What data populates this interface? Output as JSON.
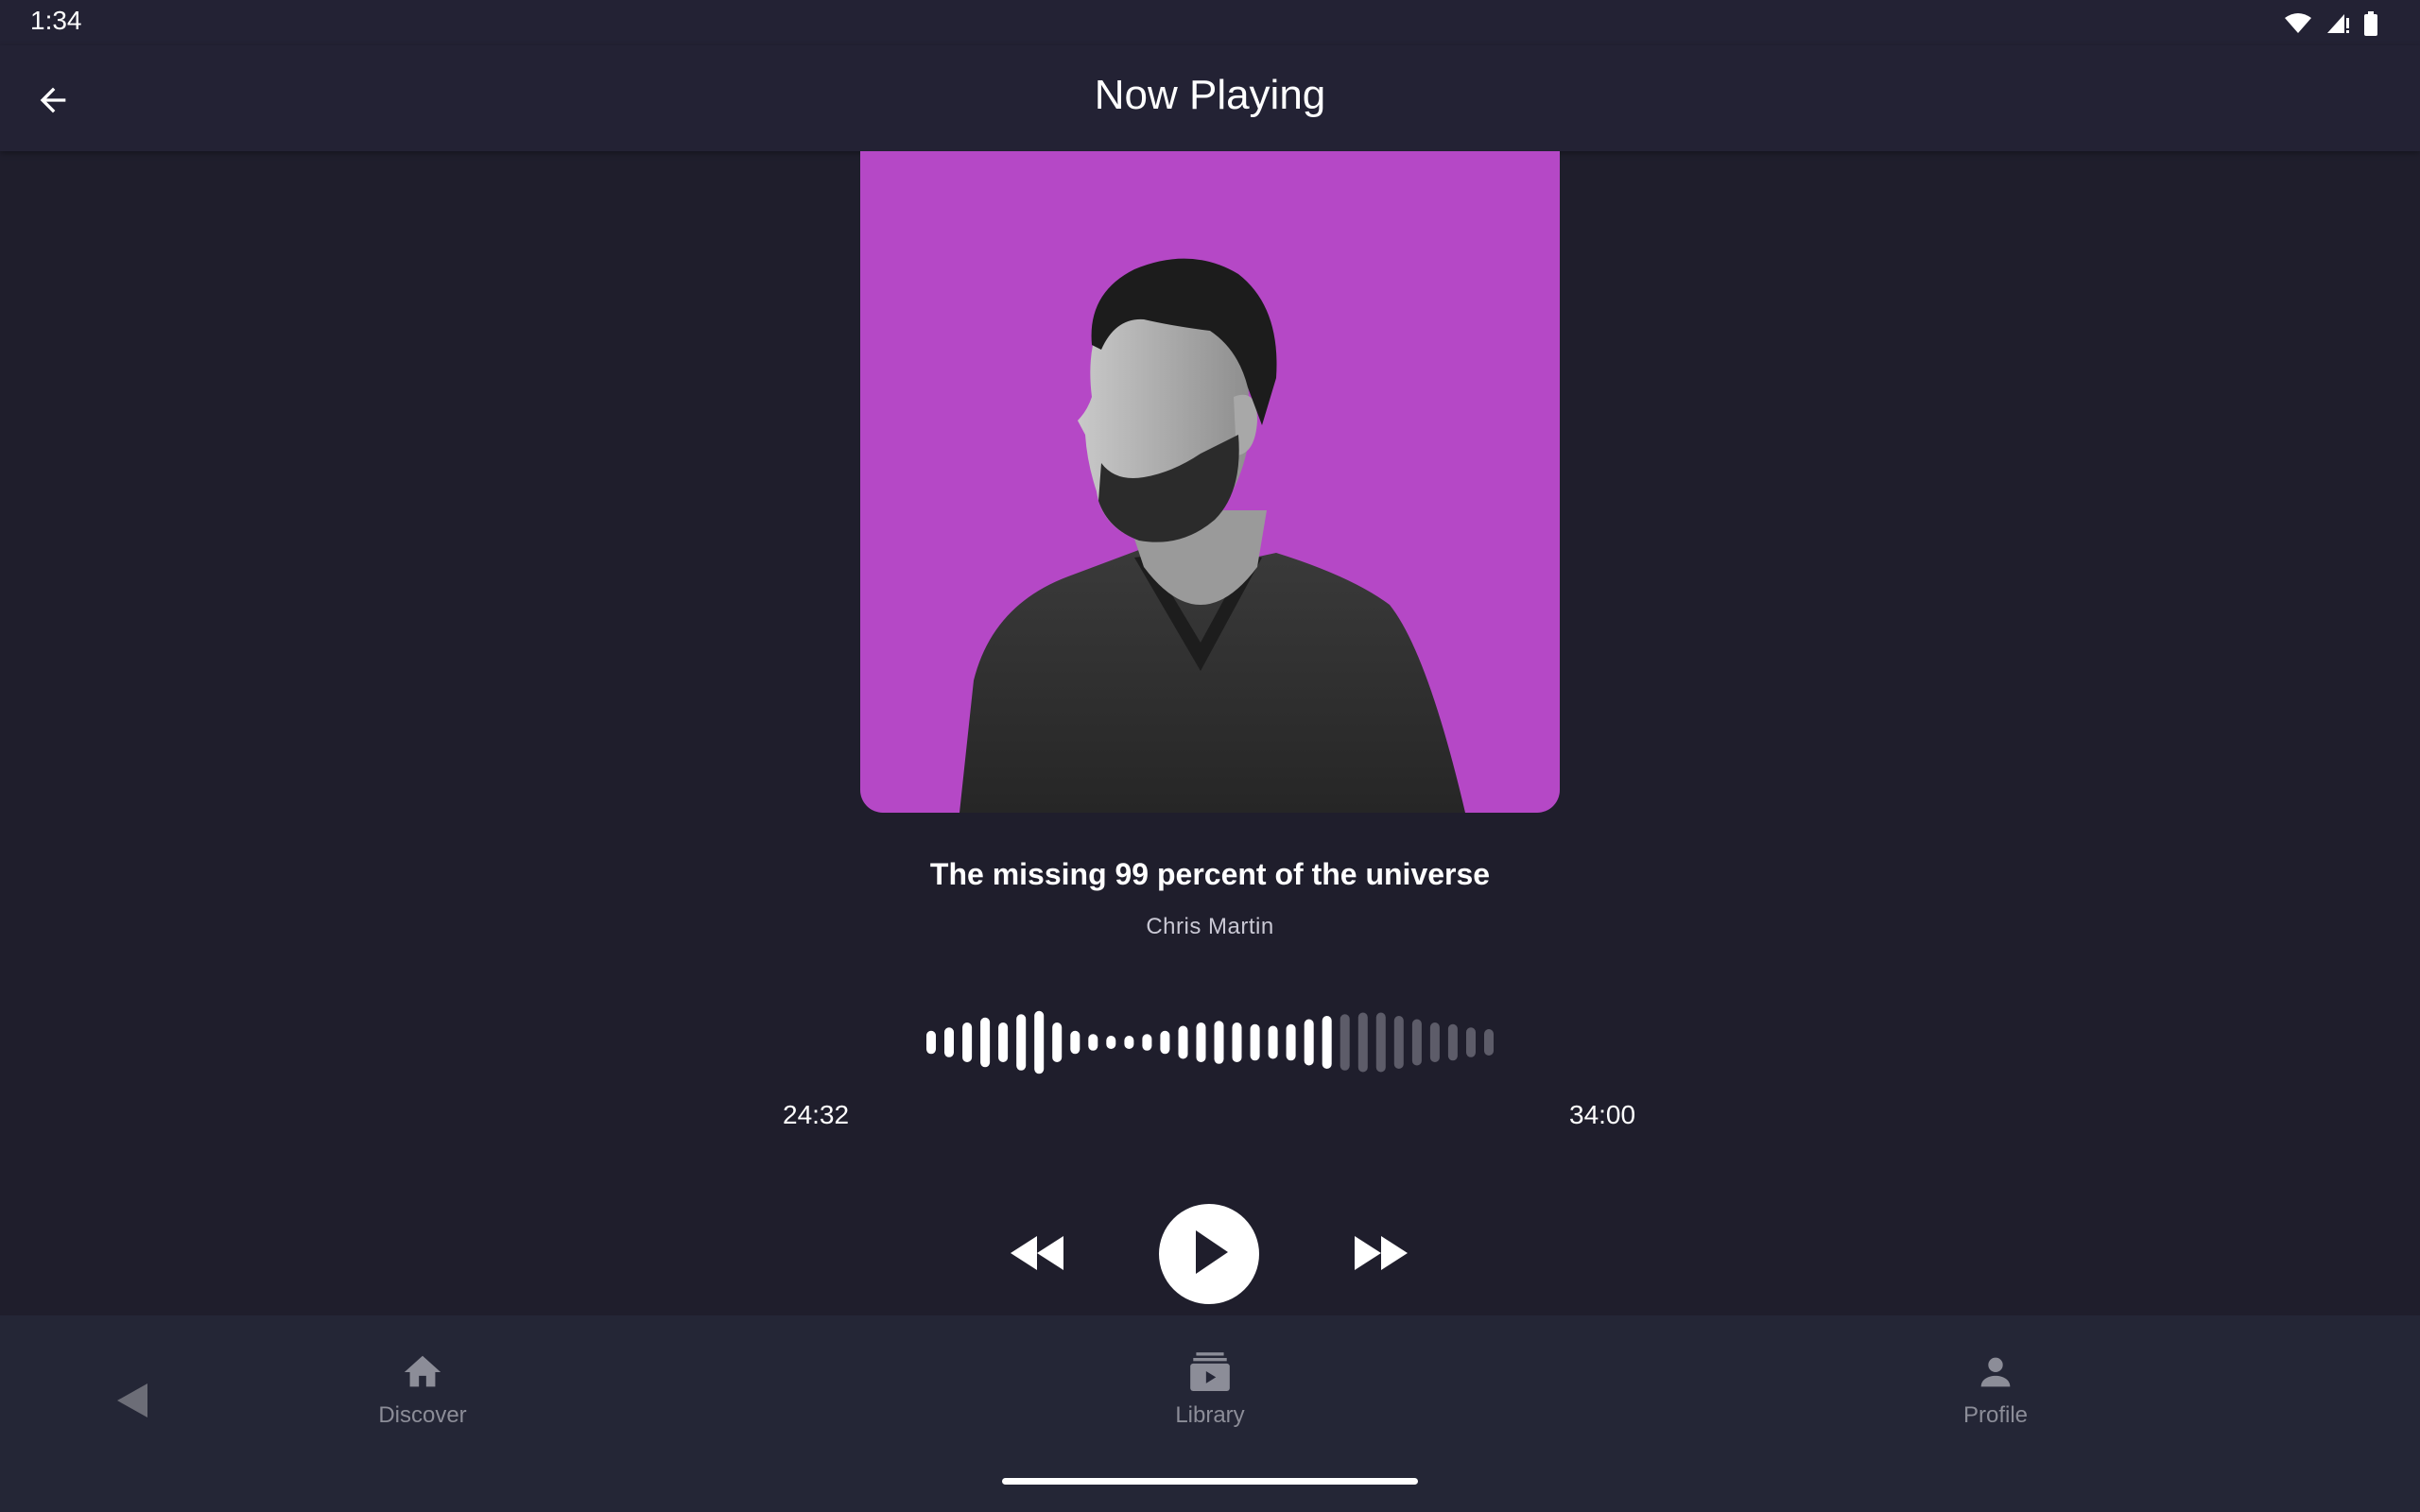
{
  "status_bar": {
    "time": "1:34",
    "icons": [
      "wifi-icon",
      "signal-icon",
      "battery-icon"
    ]
  },
  "app_bar": {
    "title": "Now Playing",
    "back_icon": "arrow-left-icon"
  },
  "track": {
    "title": "The missing 99 percent of the universe",
    "artist": "Chris Martin",
    "artwork_background": "#b548c6"
  },
  "player": {
    "elapsed": "24:32",
    "total": "34:00",
    "progress": 0.72,
    "waveform_levels": [
      0.35,
      0.45,
      0.6,
      0.75,
      0.6,
      0.85,
      0.95,
      0.6,
      0.35,
      0.25,
      0.2,
      0.2,
      0.25,
      0.35,
      0.5,
      0.6,
      0.65,
      0.6,
      0.55,
      0.5,
      0.55,
      0.7,
      0.8,
      0.85,
      0.9,
      0.9,
      0.8,
      0.7,
      0.6,
      0.55,
      0.45,
      0.4
    ],
    "played_color": "#ffffff",
    "unplayed_color": "#5d5c69",
    "controls": {
      "rewind_icon": "rewind-icon",
      "play_icon": "play-icon",
      "forward_icon": "fast-forward-icon"
    }
  },
  "bottom_nav": {
    "items": [
      {
        "label": "Discover",
        "icon": "home-icon"
      },
      {
        "label": "Library",
        "icon": "library-icon"
      },
      {
        "label": "Profile",
        "icon": "person-icon"
      }
    ]
  },
  "colors": {
    "background": "#1f1e2c",
    "bar": "#232234",
    "nav": "#242636",
    "nav_inactive": "#8c8d98"
  }
}
